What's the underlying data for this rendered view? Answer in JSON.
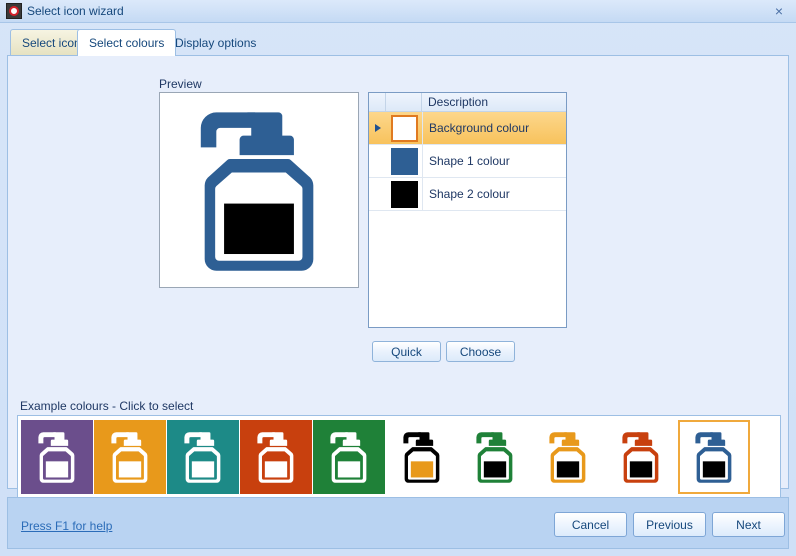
{
  "window": {
    "title": "Select icon wizard",
    "icon": "app-ring-icon",
    "close_label": "×"
  },
  "tabs": [
    {
      "label": "Select icon",
      "state": "hover"
    },
    {
      "label": "Select colours",
      "state": "active"
    },
    {
      "label": "Display options",
      "state": "normal"
    }
  ],
  "preview": {
    "label": "Preview",
    "background_colour": "#FFFFFF",
    "shape1_colour": "#2E5F94",
    "shape2_colour": "#000000"
  },
  "grid": {
    "columns": [
      "",
      "",
      "Description"
    ],
    "rows": [
      {
        "description": "Background colour",
        "colour": "#FFFFFF",
        "selected": true
      },
      {
        "description": "Shape 1 colour",
        "colour": "#2E5F94",
        "selected": false
      },
      {
        "description": "Shape 2 colour",
        "colour": "#000000",
        "selected": false
      }
    ],
    "row_marker": "▶"
  },
  "colour_buttons": {
    "quick": "Quick",
    "choose": "Choose"
  },
  "examples": {
    "label": "Example colours - Click to select",
    "tiles": [
      {
        "background": "#6B4E8C",
        "shape1": "#FFFFFF",
        "shape2": "#FFFFFF",
        "selected": false
      },
      {
        "background": "#E8991B",
        "shape1": "#FFFFFF",
        "shape2": "#FFFFFF",
        "selected": false
      },
      {
        "background": "#1D8A87",
        "shape1": "#FFFFFF",
        "shape2": "#FFFFFF",
        "selected": false
      },
      {
        "background": "#C8400E",
        "shape1": "#FFFFFF",
        "shape2": "#FFFFFF",
        "selected": false
      },
      {
        "background": "#1F8138",
        "shape1": "#FFFFFF",
        "shape2": "#FFFFFF",
        "selected": false
      },
      {
        "background": "#FFFFFF",
        "shape1": "#000000",
        "shape2": "#E8991B",
        "selected": false
      },
      {
        "background": "#FFFFFF",
        "shape1": "#1F8138",
        "shape2": "#000000",
        "selected": false
      },
      {
        "background": "#FFFFFF",
        "shape1": "#E8991B",
        "shape2": "#000000",
        "selected": false
      },
      {
        "background": "#FFFFFF",
        "shape1": "#C8400E",
        "shape2": "#000000",
        "selected": false
      },
      {
        "background": "#FFFFFF",
        "shape1": "#2E5F94",
        "shape2": "#000000",
        "selected": true
      }
    ]
  },
  "footer": {
    "help": "Press F1 for help",
    "cancel": "Cancel",
    "previous": "Previous",
    "next": "Next"
  },
  "theme": {
    "window_bg": "#CFE0F7",
    "panel_bg": "#E7EEFB",
    "accent": "#F8C25C",
    "selection_border": "#F0A93C",
    "link": "#2B6CB8"
  }
}
